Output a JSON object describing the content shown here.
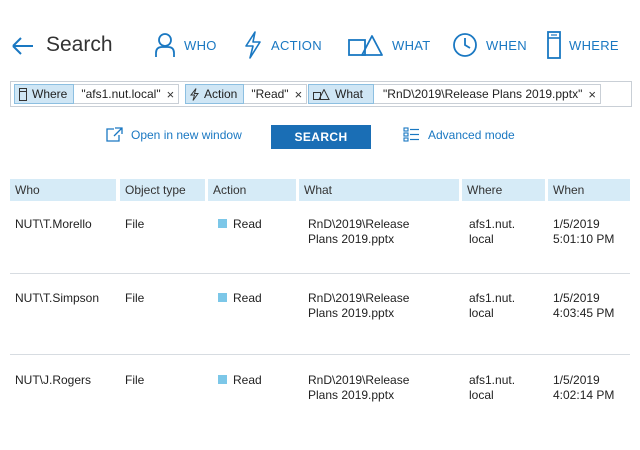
{
  "header": {
    "title": "Search",
    "nav": [
      {
        "label": "WHO",
        "icon": "person-icon"
      },
      {
        "label": "ACTION",
        "icon": "lightning-icon"
      },
      {
        "label": "WHAT",
        "icon": "object-shapes-icon"
      },
      {
        "label": "WHEN",
        "icon": "clock-icon"
      },
      {
        "label": "WHERE",
        "icon": "server-icon"
      }
    ]
  },
  "filters": [
    {
      "key": "Where",
      "value": "\"afs1.nut.local\"",
      "icon": "server-icon"
    },
    {
      "key": "Action",
      "value": "\"Read\"",
      "icon": "lightning-icon"
    },
    {
      "key": "What",
      "value": "\"RnD\\2019\\Release Plans 2019.pptx\"",
      "icon": "object-shapes-icon"
    }
  ],
  "actions": {
    "open_new_window": "Open in new window",
    "search": "SEARCH",
    "advanced_mode": "Advanced mode"
  },
  "table": {
    "columns": [
      "Who",
      "Object type",
      "Action",
      "What",
      "Where",
      "When"
    ],
    "rows": [
      {
        "who": "NUT\\T.Morello",
        "object_type": "File",
        "action": "Read",
        "what_1": "RnD\\2019\\Release",
        "what_2": "Plans 2019.pptx",
        "where_1": "afs1.nut.",
        "where_2": "local",
        "when_1": "1/5/2019",
        "when_2": "5:01:10 PM"
      },
      {
        "who": "NUT\\T.Simpson",
        "object_type": "File",
        "action": "Read",
        "what_1": "RnD\\2019\\Release",
        "what_2": "Plans 2019.pptx",
        "where_1": "afs1.nut.",
        "where_2": "local",
        "when_1": "1/5/2019",
        "when_2": "4:03:45 PM"
      },
      {
        "who": "NUT\\J.Rogers",
        "object_type": "File",
        "action": "Read",
        "what_1": "RnD\\2019\\Release",
        "what_2": "Plans 2019.pptx",
        "where_1": "afs1.nut.",
        "where_2": "local",
        "when_1": "1/5/2019",
        "when_2": "4:02:14 PM"
      }
    ]
  },
  "colors": {
    "accent": "#1a78c2",
    "button": "#1a6eb5",
    "header_bg": "#d6ebf7",
    "chip_bg": "#cfe6f5",
    "action_marker": "#7cc7e8"
  }
}
